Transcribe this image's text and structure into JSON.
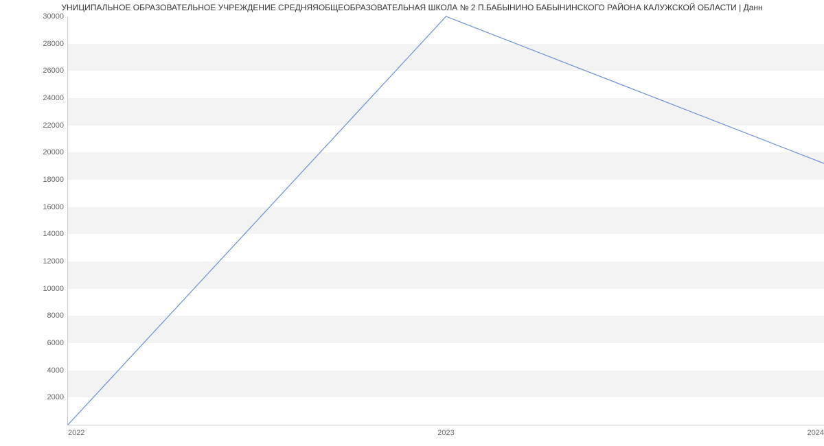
{
  "chart_data": {
    "type": "line",
    "title": "УНИЦИПАЛЬНОЕ ОБРАЗОВАТЕЛЬНОЕ УЧРЕЖДЕНИЕ СРЕДНЯЯОБЩЕОБРАЗОВАТЕЛЬНАЯ ШКОЛА № 2 П.БАБЫНИНО БАБЫНИНСКОГО РАЙОНА КАЛУЖСКОЙ ОБЛАСТИ | Данн",
    "x": [
      2022,
      2023,
      2024
    ],
    "values": [
      0,
      30000,
      19200
    ],
    "xlabel": "",
    "ylabel": "",
    "ylim": [
      0,
      30000
    ],
    "y_ticks": [
      2000,
      4000,
      6000,
      8000,
      10000,
      12000,
      14000,
      16000,
      18000,
      20000,
      22000,
      24000,
      26000,
      28000,
      30000
    ],
    "x_ticks": [
      "2022",
      "2023",
      "2024"
    ],
    "line_color": "#6b8fd4"
  }
}
